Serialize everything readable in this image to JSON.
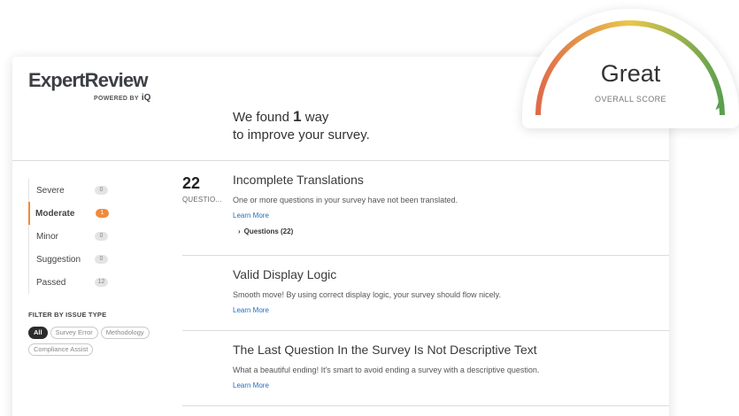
{
  "brand": {
    "name": "ExpertReview",
    "powered_by": "POWERED BY",
    "powered_brand": "iQ"
  },
  "headline": {
    "prefix": "We found",
    "count": "1",
    "suffix": "way",
    "line2": "to improve your survey."
  },
  "severity_filters": [
    {
      "label": "Severe",
      "count": "0",
      "active": false
    },
    {
      "label": "Moderate",
      "count": "1",
      "active": true
    },
    {
      "label": "Minor",
      "count": "0",
      "active": false
    },
    {
      "label": "Suggestion",
      "count": "0",
      "active": false
    },
    {
      "label": "Passed",
      "count": "12",
      "active": false
    }
  ],
  "filter_by_type": {
    "title": "FILTER BY ISSUE TYPE",
    "chips": [
      "All",
      "Survey Error",
      "Methodology",
      "Compliance Assist"
    ]
  },
  "question_count": {
    "value": "22",
    "label": "QUESTIO..."
  },
  "issues": [
    {
      "title": "Incomplete Translations",
      "description": "One or more questions in your survey have not been translated.",
      "link": "Learn More",
      "toggle": "Questions (22)"
    },
    {
      "title": "Valid Display Logic",
      "description": "Smooth move! By using correct display logic, your survey should flow nicely.",
      "link": "Learn More"
    },
    {
      "title": "The Last Question In the Survey Is Not Descriptive Text",
      "description": "What a beautiful ending! It's smart to avoid ending a survey with a descriptive question.",
      "link": "Learn More"
    }
  ],
  "score": {
    "value": "Great",
    "label": "OVERALL SCORE",
    "level": 0.97
  },
  "colors": {
    "accent": "#f08a3c",
    "link": "#1f6fc6",
    "gauge_low": "#e06a4a",
    "gauge_mid": "#e9c74b",
    "gauge_high": "#5aa04f"
  }
}
